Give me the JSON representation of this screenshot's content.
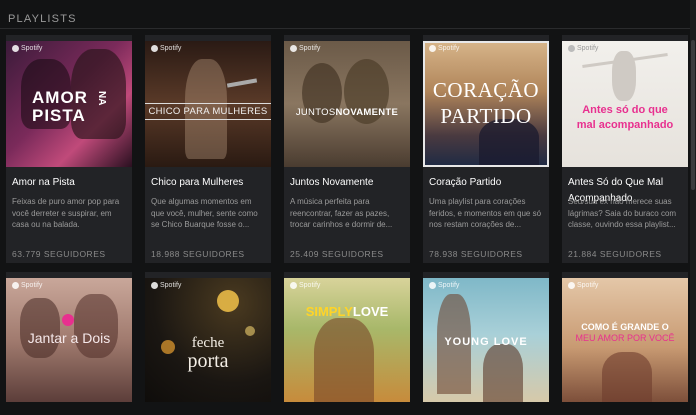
{
  "section": {
    "title": "PLAYLISTS"
  },
  "brand": {
    "logo_text": "Spotify"
  },
  "playlists": [
    {
      "title": "Amor na Pista",
      "description": "Feixas de puro amor pop para você derreter e suspirar, em casa ou na balada.",
      "followers": "63.779 SEGUIDORES",
      "cover_lines": [
        "AMOR",
        "PISTA"
      ],
      "cover_side": "NA"
    },
    {
      "title": "Chico para Mulheres",
      "description": "Que algumas momentos em que você, mulher, sente como se Chico Buarque fosse o...",
      "followers": "18.988 SEGUIDORES",
      "cover_text": "CHICO PARA MULHERES"
    },
    {
      "title": "Juntos Novamente",
      "description": "A música perfeita para reencontrar, fazer as pazes, trocar carinhos e dormir de...",
      "followers": "25.409 SEGUIDORES",
      "cover_text_a": "JUNTOS",
      "cover_text_b": "NOVAMENTE"
    },
    {
      "title": "Coração Partido",
      "description": "Uma playlist para corações feridos, e momentos em que só nos restam corações de...",
      "followers": "78.938 SEGUIDORES",
      "cover_lines": [
        "CORAÇÃO",
        "PARTIDO"
      ]
    },
    {
      "title": "Antes Só do Que Mal Acompanhado",
      "description": "Seu/sua ex não merece suas lágrimas? Saia do buraco com classe, ouvindo essa playlist...",
      "followers": "21.884 SEGUIDORES",
      "cover_lines": [
        "Antes só do que",
        "mal acompanhado"
      ]
    },
    {
      "cover_lines": [
        "Jantar a Dois"
      ]
    },
    {
      "cover_lines": [
        "feche",
        "porta"
      ]
    },
    {
      "cover_text_a": "SIMPLY",
      "cover_text_b": "LOVE"
    },
    {
      "cover_text": "YOUNG LOVE"
    },
    {
      "cover_lines": [
        "COMO É GRANDE O",
        "MEU AMOR POR VOCÊ"
      ]
    }
  ],
  "colors": {
    "background": "#121314",
    "card": "#222326",
    "muted_text": "#9a9a9a",
    "cover_pink": "#e8308f"
  },
  "icons": [
    "spotify-logo-icon"
  ]
}
